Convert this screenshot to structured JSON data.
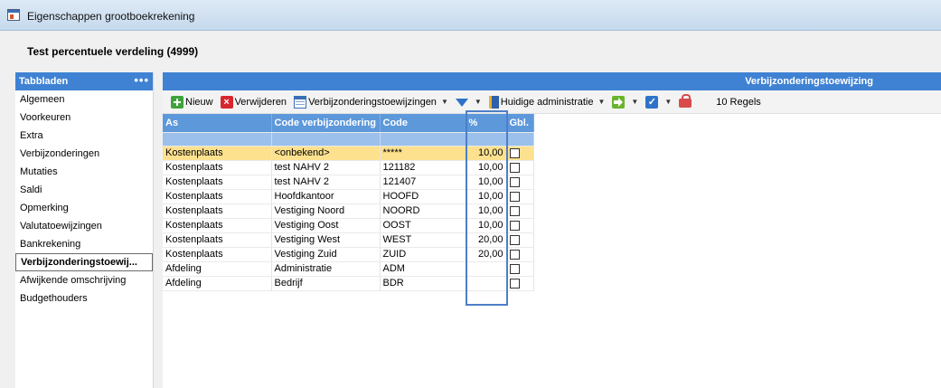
{
  "window": {
    "title": "Eigenschappen grootboekrekening"
  },
  "record": {
    "title": "Test percentuele verdeling (4999)"
  },
  "sidebar": {
    "header": "Tabbladen",
    "menu_glyph": "•••",
    "items": [
      {
        "label": "Algemeen"
      },
      {
        "label": "Voorkeuren"
      },
      {
        "label": "Extra"
      },
      {
        "label": "Verbijzonderingen"
      },
      {
        "label": "Mutaties"
      },
      {
        "label": "Saldi"
      },
      {
        "label": "Opmerking"
      },
      {
        "label": "Valutatoewijzingen"
      },
      {
        "label": "Bankrekening"
      },
      {
        "label": "Verbijzonderingstoewij..."
      },
      {
        "label": "Afwijkende omschrijving"
      },
      {
        "label": "Budgethouders"
      }
    ],
    "active_index": 9
  },
  "panel": {
    "title": "Verbijzonderingstoewijzing"
  },
  "toolbar": {
    "new_label": "Nieuw",
    "delete_label": "Verwijderen",
    "assignments_label": "Verbijzonderingstoewijzingen",
    "admin_label": "Huidige administratie",
    "rows_label": "10 Regels"
  },
  "colors": {
    "accent": "#3f82d3",
    "header": "#5d98db",
    "selected_row": "#fde18f"
  },
  "table": {
    "columns": [
      "As",
      "Code verbijzondering",
      "Code",
      "%",
      "Gbl."
    ],
    "rows": [
      {
        "as": "Kostenplaats",
        "code_verb": "<onbekend>",
        "code": "*****",
        "pct": "10,00",
        "gbl": false
      },
      {
        "as": "Kostenplaats",
        "code_verb": "test NAHV 2",
        "code": "121182",
        "pct": "10,00",
        "gbl": false
      },
      {
        "as": "Kostenplaats",
        "code_verb": "test NAHV 2",
        "code": "121407",
        "pct": "10,00",
        "gbl": false
      },
      {
        "as": "Kostenplaats",
        "code_verb": "Hoofdkantoor",
        "code": "HOOFD",
        "pct": "10,00",
        "gbl": false
      },
      {
        "as": "Kostenplaats",
        "code_verb": "Vestiging Noord",
        "code": "NOORD",
        "pct": "10,00",
        "gbl": false
      },
      {
        "as": "Kostenplaats",
        "code_verb": "Vestiging Oost",
        "code": "OOST",
        "pct": "10,00",
        "gbl": false
      },
      {
        "as": "Kostenplaats",
        "code_verb": "Vestiging West",
        "code": "WEST",
        "pct": "20,00",
        "gbl": false
      },
      {
        "as": "Kostenplaats",
        "code_verb": "Vestiging Zuid",
        "code": "ZUID",
        "pct": "20,00",
        "gbl": false
      },
      {
        "as": "Afdeling",
        "code_verb": "Administratie",
        "code": "ADM",
        "pct": "",
        "gbl": false
      },
      {
        "as": "Afdeling",
        "code_verb": "Bedrijf",
        "code": "BDR",
        "pct": "",
        "gbl": false
      }
    ]
  }
}
